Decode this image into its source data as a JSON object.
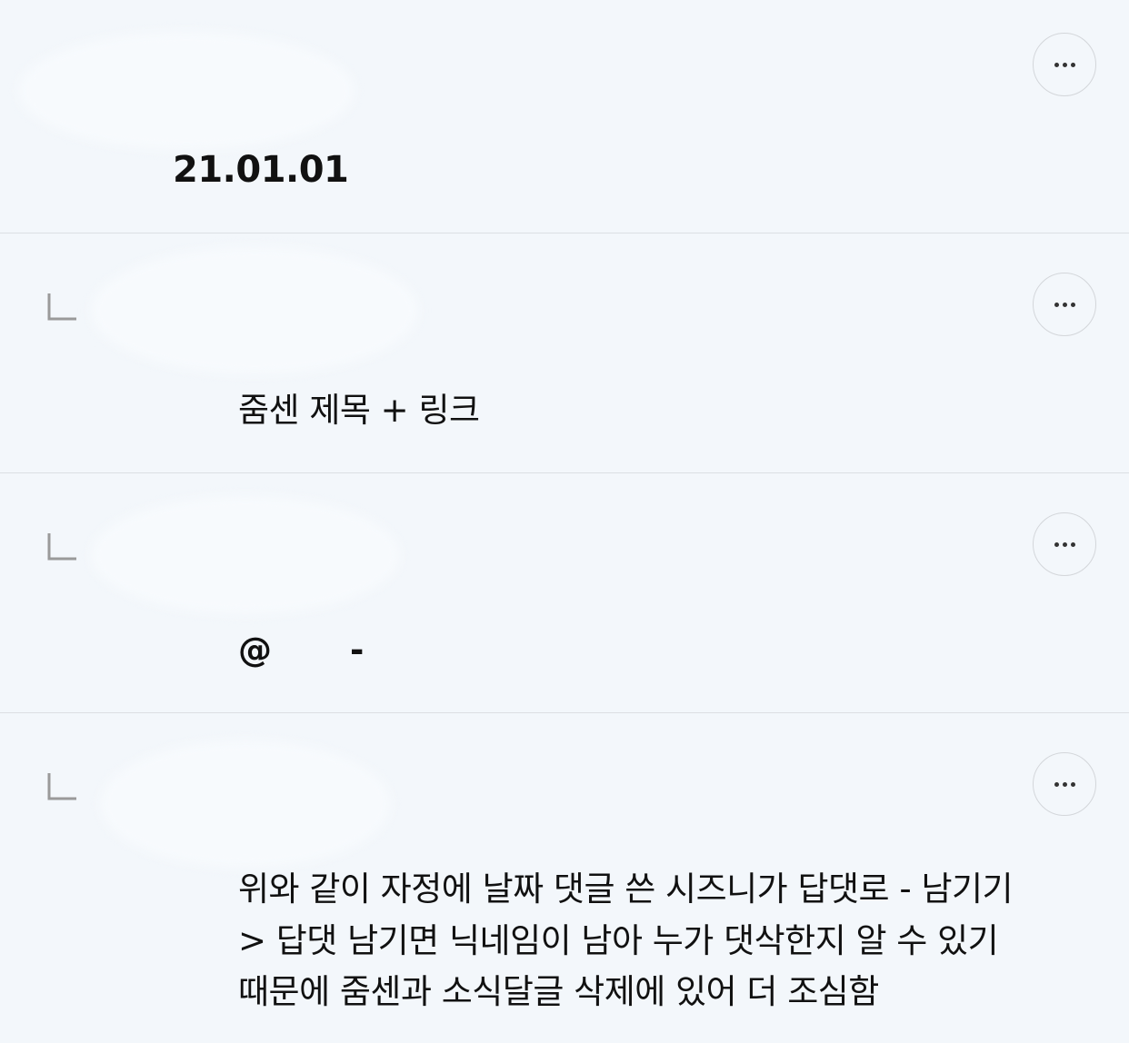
{
  "comments": [
    {
      "type": "comment",
      "text": "21.01.01",
      "more_icon": "more-horizontal-icon"
    },
    {
      "type": "reply",
      "reply_icon": "reply-arrow-icon",
      "text": "줌센 제목 + 링크",
      "more_icon": "more-horizontal-icon"
    },
    {
      "type": "reply",
      "reply_icon": "reply-arrow-icon",
      "mention": "@",
      "dash": "-",
      "more_icon": "more-horizontal-icon"
    },
    {
      "type": "reply",
      "reply_icon": "reply-arrow-icon",
      "lines": [
        "위와 같이 자정에 날짜 댓글 쓴 시즈니가 답댓로 - 남기기",
        "> 답댓 남기면 닉네임이 남아 누가 댓삭한지 알 수 있기",
        "때문에 줌센과 소식달글 삭제에 있어 더 조심함"
      ],
      "more_icon": "more-horizontal-icon"
    }
  ],
  "colors": {
    "background": "#f3f7fb",
    "divider": "#dcdfe3",
    "text": "#111111",
    "icon": "#9a9a9a"
  }
}
